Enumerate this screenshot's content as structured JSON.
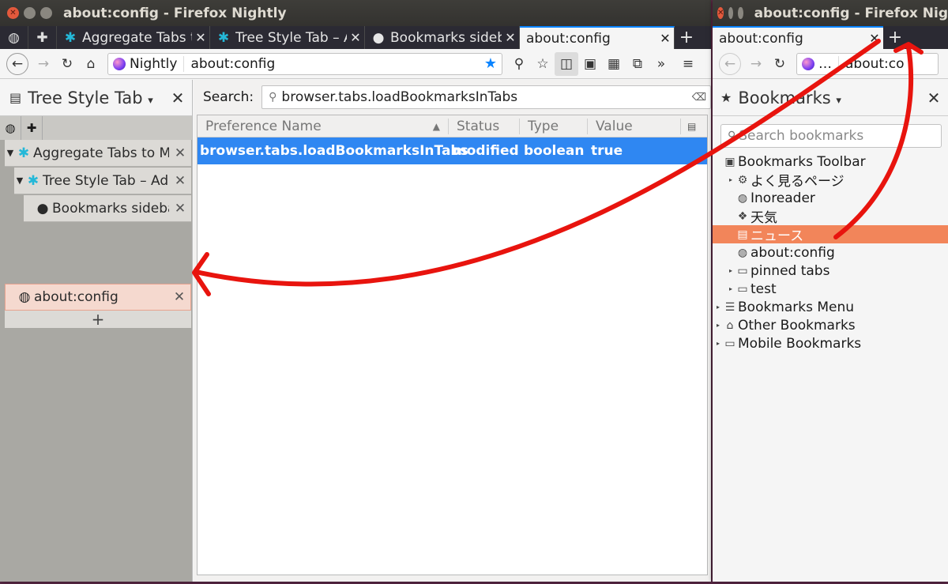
{
  "left_window": {
    "title": "about:config - Firefox Nightly",
    "tabs": [
      {
        "label": "Aggregate Tabs to M",
        "icon": "puzzle-icon"
      },
      {
        "label": "Tree Style Tab – Ad",
        "icon": "puzzle-icon"
      },
      {
        "label": "Bookmarks sideba",
        "icon": "github-icon"
      },
      {
        "label": "about:config",
        "icon": "none",
        "active": true
      }
    ],
    "url_identity": "Nightly",
    "url": "about:config",
    "sidebar": {
      "title": "Tree Style Tab",
      "tabs": [
        {
          "label": "Aggregate Tabs to M",
          "level": 0,
          "twisty": "▾"
        },
        {
          "label": "Tree Style Tab – Ad",
          "level": 1,
          "twisty": "▾"
        },
        {
          "label": "Bookmarks sideba",
          "level": 2
        },
        {
          "label": "about:config",
          "level": 0,
          "active": true
        }
      ],
      "new_tab": "+"
    },
    "config": {
      "search_label": "Search:",
      "search_value": "browser.tabs.loadBookmarksInTabs",
      "columns": [
        "Preference Name",
        "Status",
        "Type",
        "Value"
      ],
      "rows": [
        {
          "name": "browser.tabs.loadBookmarksInTabs",
          "status": "modified",
          "type": "boolean",
          "value": "true"
        }
      ]
    }
  },
  "right_window": {
    "title": "about:config - Firefox Nig",
    "tab_label": "about:config",
    "url_identity": "…",
    "url": "about:co",
    "sidebar": {
      "title": "Bookmarks",
      "search_placeholder": "Search bookmarks",
      "items": [
        {
          "label": "Bookmarks Toolbar",
          "depth": 0,
          "icon": "toolbar-icon"
        },
        {
          "label": "よく見るページ",
          "depth": 1,
          "icon": "gear-icon",
          "twisty": true
        },
        {
          "label": "Inoreader",
          "depth": 1,
          "icon": "globe-icon"
        },
        {
          "label": "天気",
          "depth": 1,
          "icon": "weather-icon"
        },
        {
          "label": "ニュース",
          "depth": 1,
          "icon": "news-icon",
          "selected": true
        },
        {
          "label": "about:config",
          "depth": 1,
          "icon": "globe-icon"
        },
        {
          "label": "pinned tabs",
          "depth": 1,
          "icon": "folder-icon",
          "twisty": true
        },
        {
          "label": "test",
          "depth": 1,
          "icon": "folder-icon",
          "twisty": true
        },
        {
          "label": "Bookmarks Menu",
          "depth": 0,
          "icon": "menu-icon",
          "twisty": true
        },
        {
          "label": "Other Bookmarks",
          "depth": 0,
          "icon": "tray-icon",
          "twisty": true
        },
        {
          "label": "Mobile Bookmarks",
          "depth": 0,
          "icon": "folder-icon",
          "twisty": true
        }
      ]
    }
  },
  "colors": {
    "accent": "#0a84ff",
    "selection": "#2f87f2",
    "bookmark_selected": "#f2855a",
    "arrow": "#e8140e"
  }
}
